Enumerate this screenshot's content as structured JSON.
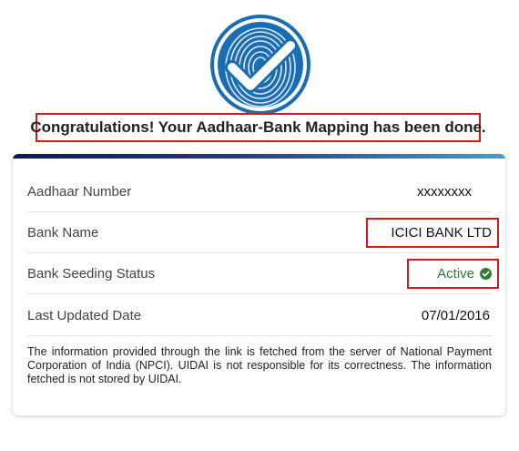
{
  "header": {
    "headline": "Congratulations! Your Aadhaar-Bank Mapping has been done."
  },
  "details": {
    "rows": [
      {
        "label": "Aadhaar Number",
        "value": "xxxxxxxx"
      },
      {
        "label": "Bank Name",
        "value": "ICICI BANK LTD"
      },
      {
        "label": "Bank Seeding Status",
        "value": "Active"
      },
      {
        "label": "Last Updated Date",
        "value": "07/01/2016"
      }
    ]
  },
  "disclaimer": "The information provided through the link is fetched from the server of National Payment Corporation of India (NPCI). UIDAI is not responsible for its correctness. The information fetched is not stored by UIDAI.",
  "colors": {
    "logo_blue": "#1a6db3",
    "highlight_red": "#d11a1a",
    "status_green": "#2e7d32",
    "accent_dark": "#0b1a5c",
    "accent_light": "#3aa0d8"
  },
  "icons": {
    "logo": "fingerprint-check-icon",
    "status": "check-circle-icon"
  }
}
